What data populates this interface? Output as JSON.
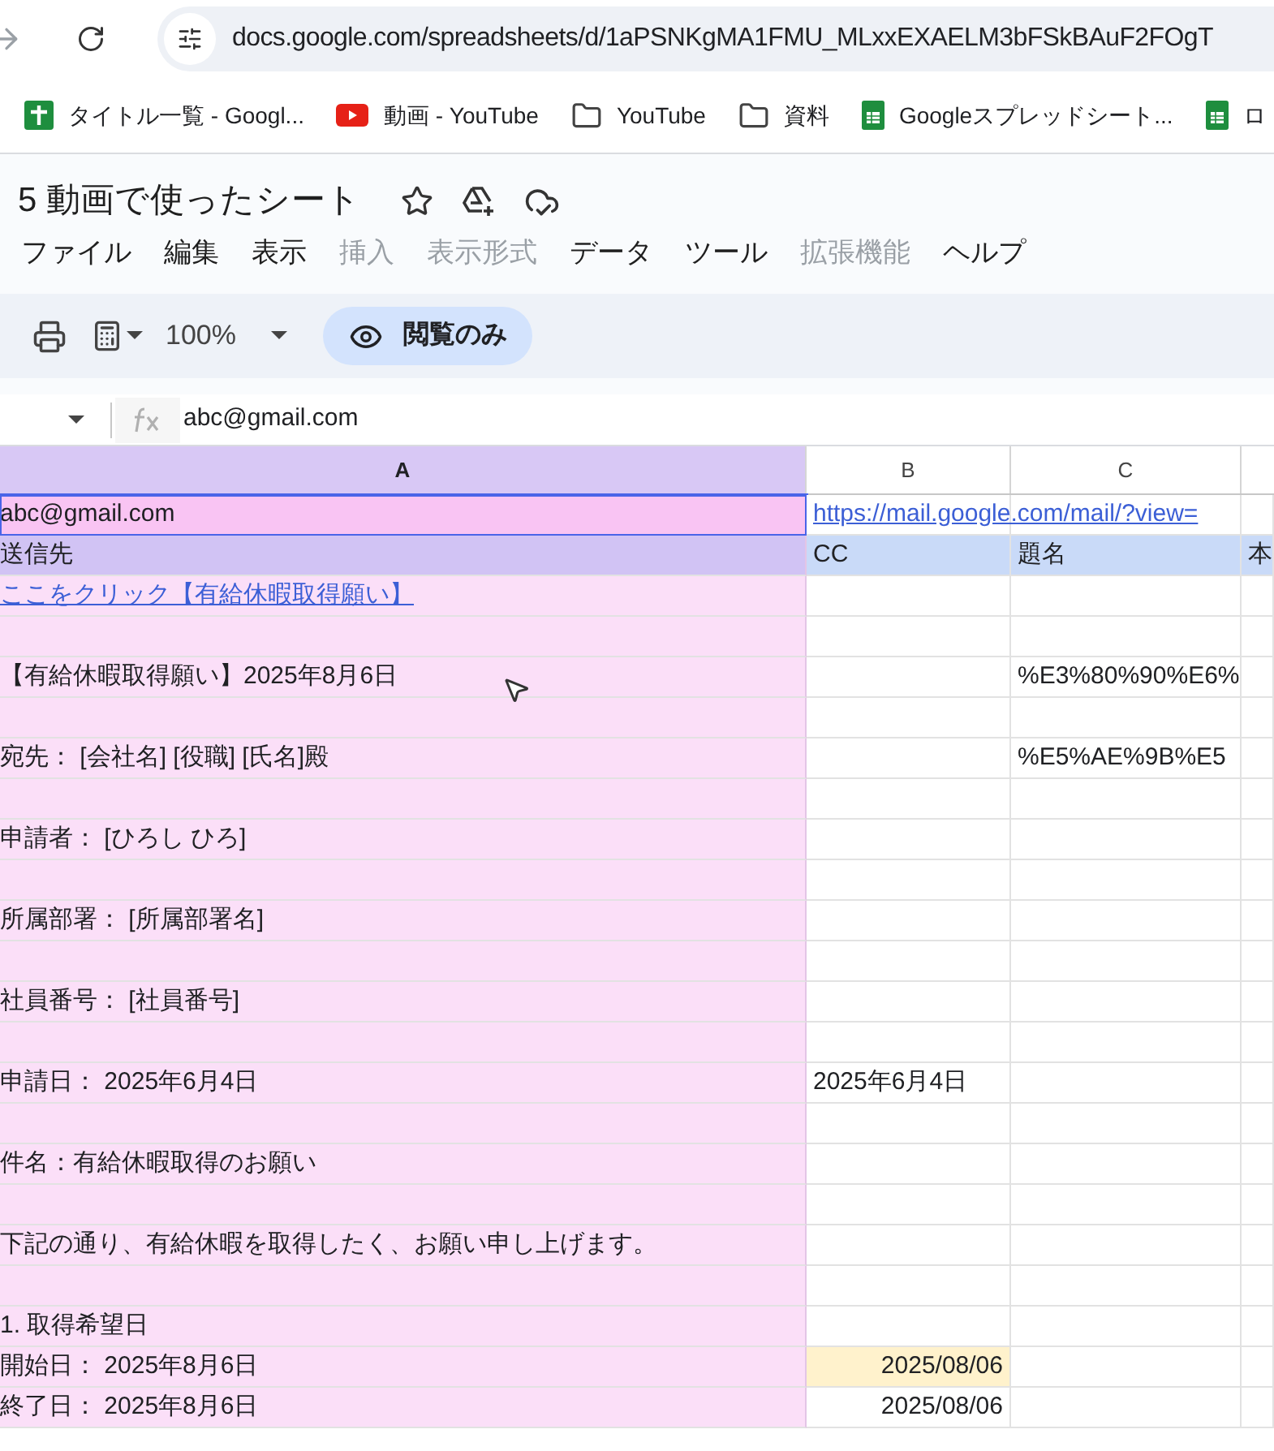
{
  "browser": {
    "url": "docs.google.com/spreadsheets/d/1aPSNKgMA1FMU_MLxxEXAELM3bFSkBAuF2FOgT",
    "bookmarks": [
      {
        "label": "タイトル一覧 - Googl...",
        "kind": "sheets-plus"
      },
      {
        "label": "動画 - YouTube",
        "kind": "youtube"
      },
      {
        "label": "YouTube",
        "kind": "folder"
      },
      {
        "label": "資料",
        "kind": "folder"
      },
      {
        "label": "Googleスプレッドシート...",
        "kind": "sheets"
      },
      {
        "label": "ロ",
        "kind": "sheets"
      }
    ]
  },
  "document": {
    "title": "5 動画で使ったシート",
    "menus": [
      {
        "label": "ファイル",
        "disabled": false
      },
      {
        "label": "編集",
        "disabled": false
      },
      {
        "label": "表示",
        "disabled": false
      },
      {
        "label": "挿入",
        "disabled": true
      },
      {
        "label": "表示形式",
        "disabled": true
      },
      {
        "label": "データ",
        "disabled": false
      },
      {
        "label": "ツール",
        "disabled": false
      },
      {
        "label": "拡張機能",
        "disabled": true
      },
      {
        "label": "ヘルプ",
        "disabled": false
      }
    ]
  },
  "toolbar": {
    "zoom": "100%",
    "mode": "閲覧のみ"
  },
  "formula_bar": {
    "value": "abc@gmail.com"
  },
  "grid": {
    "columns": [
      {
        "label": "A",
        "selected": true
      },
      {
        "label": "B",
        "selected": false
      },
      {
        "label": "C",
        "selected": false
      }
    ],
    "rows": [
      {
        "kind": "selected",
        "a": {
          "text": "abc@gmail.com",
          "kind": "text"
        },
        "b": {
          "text": "https://mail.google.com/mail/?view=",
          "kind": "link"
        }
      },
      {
        "kind": "header",
        "a": {
          "text": "送信先",
          "kind": "text"
        },
        "b": {
          "text": "CC",
          "kind": "text"
        },
        "c": {
          "text": "題名",
          "kind": "text"
        },
        "d": {
          "text": "本",
          "kind": "text"
        }
      },
      {
        "kind": "body",
        "a": {
          "text": "ここをクリック【有給休暇取得願い】",
          "kind": "link"
        }
      },
      {
        "kind": "body"
      },
      {
        "kind": "body",
        "a": {
          "text": "【有給休暇取得願い】2025年8月6日",
          "kind": "text"
        },
        "c": {
          "text": "%E3%80%90%E6%",
          "kind": "text"
        }
      },
      {
        "kind": "body"
      },
      {
        "kind": "body",
        "a": {
          "text": "宛先： [会社名] [役職] [氏名]殿",
          "kind": "text"
        },
        "c": {
          "text": "%E5%AE%9B%E5",
          "kind": "text"
        }
      },
      {
        "kind": "body"
      },
      {
        "kind": "body",
        "a": {
          "text": "申請者： [ひろし ひろ]",
          "kind": "text"
        }
      },
      {
        "kind": "body"
      },
      {
        "kind": "body",
        "a": {
          "text": "所属部署： [所属部署名]",
          "kind": "text"
        }
      },
      {
        "kind": "body"
      },
      {
        "kind": "body",
        "a": {
          "text": "社員番号： [社員番号]",
          "kind": "text"
        }
      },
      {
        "kind": "body"
      },
      {
        "kind": "body",
        "a": {
          "text": "申請日： 2025年6月4日",
          "kind": "text"
        },
        "b": {
          "text": "2025年6月4日",
          "kind": "text"
        }
      },
      {
        "kind": "body"
      },
      {
        "kind": "body",
        "a": {
          "text": "件名：有給休暇取得のお願い",
          "kind": "text"
        }
      },
      {
        "kind": "body"
      },
      {
        "kind": "body",
        "a": {
          "text": "下記の通り、有給休暇を取得したく、お願い申し上げます。",
          "kind": "text"
        }
      },
      {
        "kind": "body"
      },
      {
        "kind": "body",
        "a": {
          "text": "1. 取得希望日",
          "kind": "text"
        }
      },
      {
        "kind": "body",
        "a": {
          "text": "開始日： 2025年8月6日",
          "kind": "text"
        },
        "b": {
          "text": "2025/08/06",
          "kind": "date",
          "highlighted": true
        }
      },
      {
        "kind": "body",
        "a": {
          "text": "終了日： 2025年8月6日",
          "kind": "text"
        },
        "b": {
          "text": "2025/08/06",
          "kind": "date",
          "highlighted": false
        }
      }
    ]
  }
}
